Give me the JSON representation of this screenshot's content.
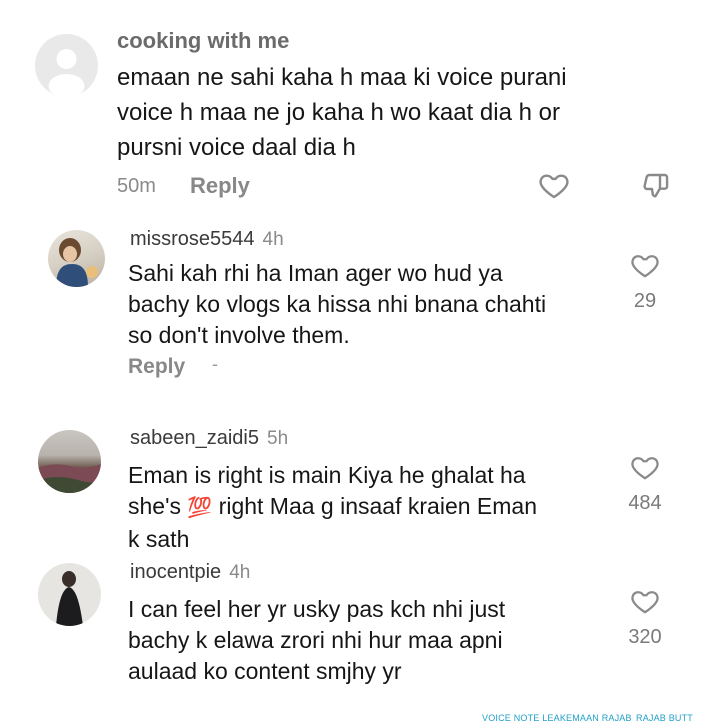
{
  "main_comment": {
    "username": "cooking with me",
    "text_lines": [
      "emaan ne sahi kaha h maa ki voice purani",
      "voice h maa ne jo kaha h wo kaat dia h or",
      "pursni voice daal dia h"
    ],
    "time": "50m",
    "reply_label": "Reply"
  },
  "replies": [
    {
      "username": "missrose5544",
      "time": "4h",
      "text_lines": [
        "Sahi kah rhi ha Iman ager wo hud ya",
        "bachy ko vlogs ka hissa nhi bnana chahti",
        "so don't involve them."
      ],
      "likes": "29",
      "reply_label": "Reply",
      "reply_extra": "-"
    },
    {
      "username": "sabeen_zaidi5",
      "time": "5h",
      "text_lines": [
        "Eman is right is main Kiya he ghalat ha",
        "she's",
        "right Maa g insaaf kraien Eman",
        "k sath"
      ],
      "emoji": "💯",
      "likes": "484"
    },
    {
      "username": "inocentpie",
      "time": "4h",
      "text_lines": [
        "I can feel her yr usky pas kch nhi just",
        "bachy k elawa zrori nhi hur maa apni",
        "aulaad ko content smjhy yr"
      ],
      "likes": "320"
    }
  ],
  "footer": [
    "VOICE NOTE LEAK",
    "EMAAN RAJAB",
    "RAJAB BUTT"
  ],
  "icons": {
    "heart": "heart-icon",
    "dislike": "thumbs-down-icon",
    "default_avatar": "default-avatar-icon"
  }
}
